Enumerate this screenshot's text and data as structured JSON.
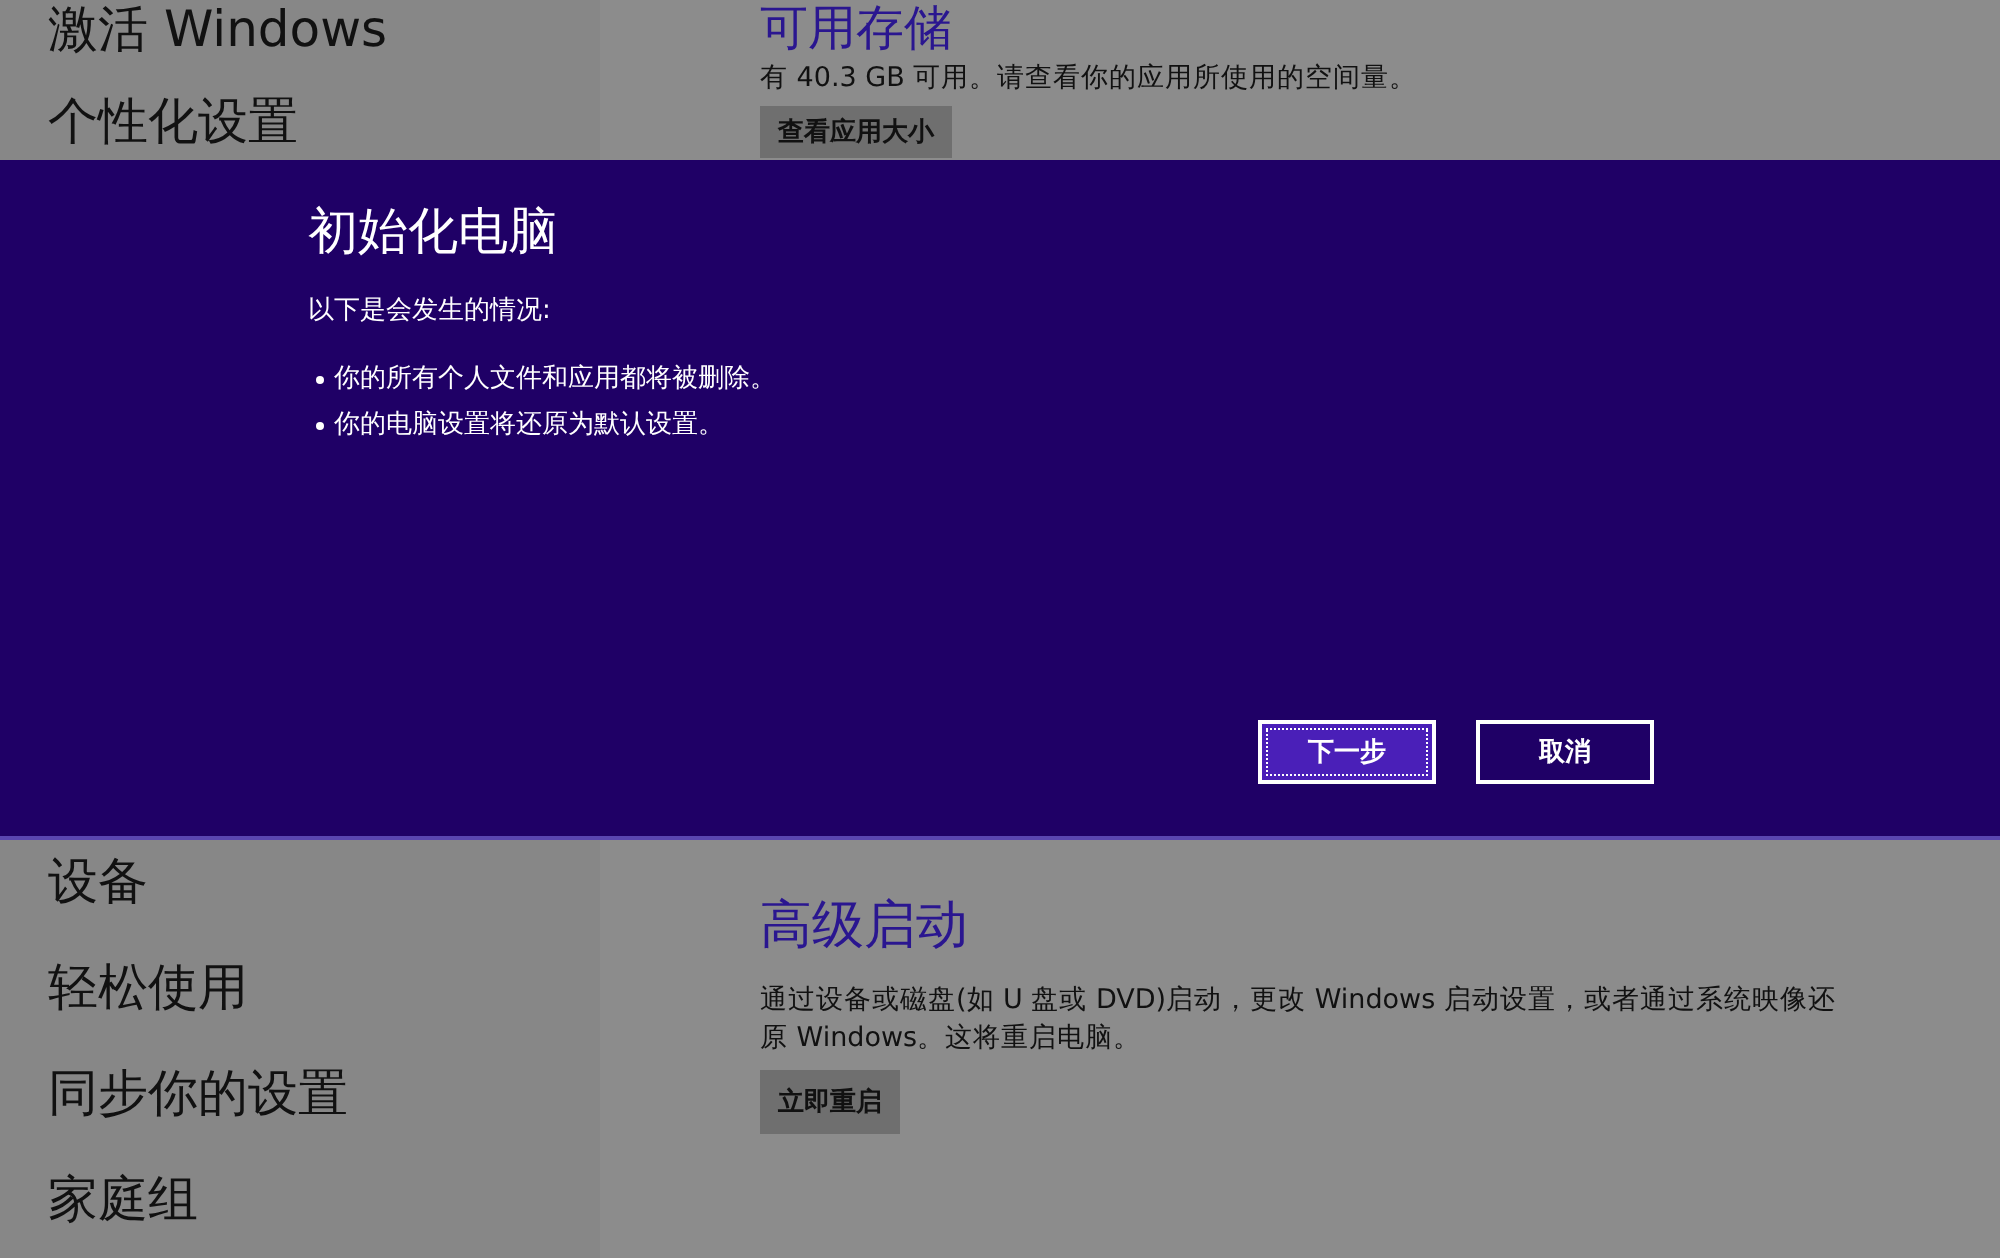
{
  "sidebar": {
    "items_top": [
      "激活 Windows",
      "个性化设置"
    ],
    "items_bottom": [
      "设备",
      "轻松使用",
      "同步你的设置",
      "家庭组"
    ]
  },
  "storage": {
    "title": "可用存储",
    "text": "有 40.3 GB 可用。请查看你的应用所使用的空间量。",
    "button": "查看应用大小"
  },
  "advanced_startup": {
    "title": "高级启动",
    "text": "通过设备或磁盘(如 U 盘或 DVD)启动，更改 Windows 启动设置，或者通过系统映像还原 Windows。这将重启电脑。",
    "button": "立即重启"
  },
  "dialog": {
    "title": "初始化电脑",
    "intro": "以下是会发生的情况:",
    "bullets": [
      "你的所有个人文件和应用都将被删除。",
      "你的电脑设置将还原为默认设置。"
    ],
    "buttons": [
      {
        "label": "下一步",
        "focused": true
      },
      {
        "label": "取消",
        "focused": false
      }
    ]
  }
}
